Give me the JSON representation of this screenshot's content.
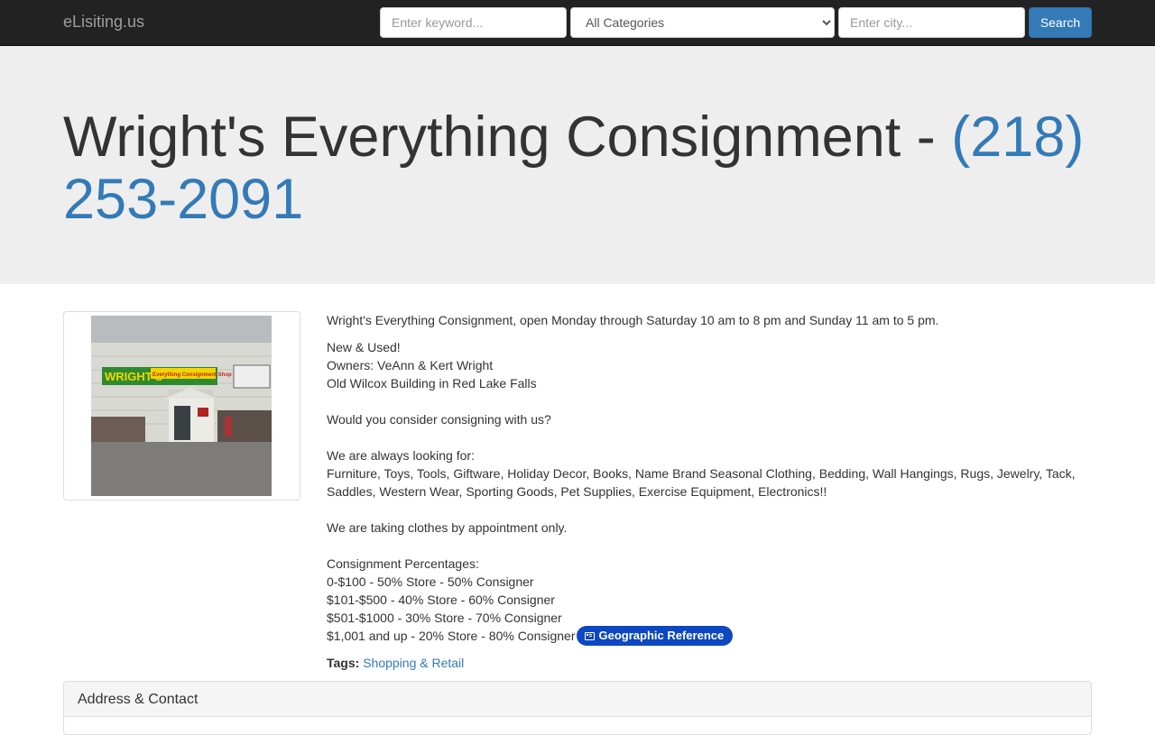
{
  "navbar": {
    "brand": "eLisiting.us",
    "keyword_placeholder": "Enter keyword...",
    "category_selected": "All Categories",
    "city_placeholder": "Enter city...",
    "search_label": "Search"
  },
  "listing": {
    "title": "Wright's Everything Consignment - ",
    "phone": "(218) 253-2091",
    "photo_sign_text": "WRIGHT'S",
    "photo_sign_subtext": "Everything Consignment Shop",
    "intro": "Wright's Everything Consignment, open Monday through Saturday 10 am to 8 pm and Sunday 11 am to 5 pm.",
    "line_new_used": "New & Used!",
    "line_owners": "Owners: VeAnn & Kert Wright",
    "line_building": "Old Wilcox Building in Red Lake Falls",
    "line_consider": "Would you consider consigning with us?",
    "line_looking": "We are always looking for:",
    "line_items": "Furniture, Toys, Tools, Giftware, Holiday Decor, Books, Name Brand Seasonal Clothing, Bedding, Wall Hangings, Rugs, Jewelry, Tack, Saddles, Western Wear, Sporting Goods, Pet Supplies, Exercise Equipment, Electronics!!",
    "line_clothes": "We are taking clothes by appointment only.",
    "line_percent_title": "Consignment Percentages:",
    "pct_1": "0-$100 - 50% Store - 50% Consigner",
    "pct_2": "$101-$500 - 40% Store - 60% Consigner",
    "pct_3": "$501-$1000 - 30% Store - 70% Consigner",
    "pct_4": "$1,001 and up - 20% Store - 80% Consigner",
    "geo_badge": "Geographic Reference",
    "tags_label": "Tags:",
    "tag_1": "Shopping & Retail"
  },
  "panel": {
    "heading": "Address & Contact"
  },
  "colors": {
    "navbar": "#222222",
    "link": "#337ab7",
    "jumbotron": "#eeeeee",
    "badge": "#0d47c1"
  }
}
